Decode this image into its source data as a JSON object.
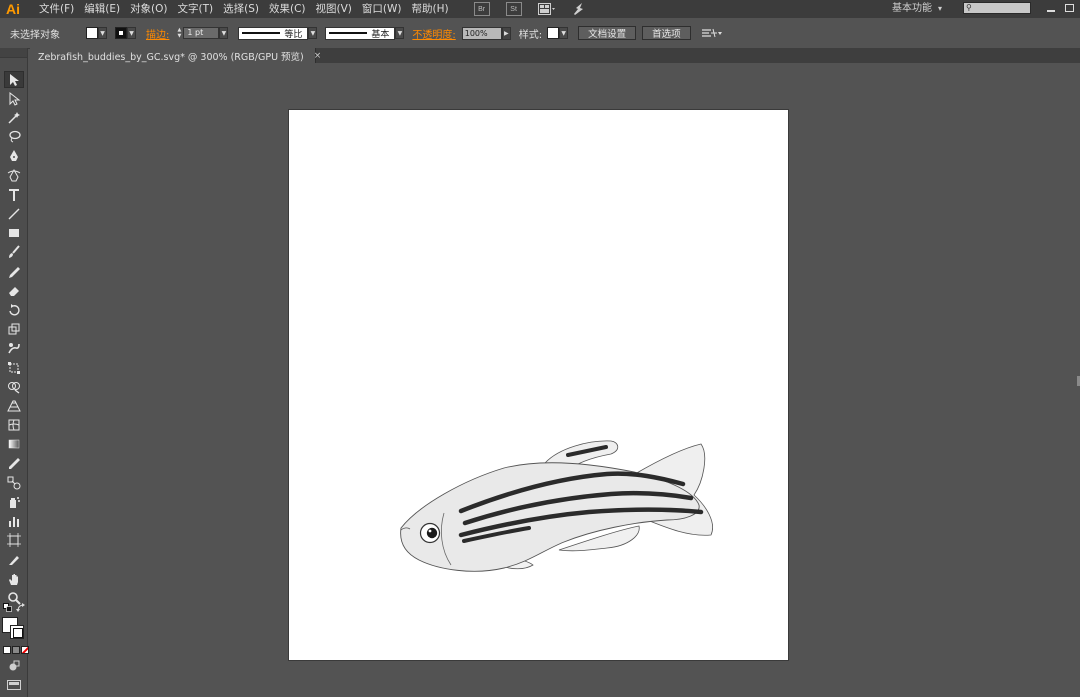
{
  "app": {
    "logo": "Ai"
  },
  "menu": [
    "文件(F)",
    "编辑(E)",
    "对象(O)",
    "文字(T)",
    "选择(S)",
    "效果(C)",
    "视图(V)",
    "窗口(W)",
    "帮助(H)"
  ],
  "menu_icons": [
    {
      "name": "bridge-icon",
      "label": "Br"
    },
    {
      "name": "stock-icon",
      "label": "St"
    },
    {
      "name": "arrange-documents-icon",
      "label": ""
    },
    {
      "name": "gpu-performance-icon",
      "label": ""
    }
  ],
  "workspace": {
    "label": "基本功能",
    "caret": "▾"
  },
  "search": {
    "placeholder": ""
  },
  "control": {
    "selection_status": "未选择对象",
    "stroke_label": "描边:",
    "stroke_weight": "1 pt",
    "profile1_label": "等比",
    "profile2_label": "基本",
    "opacity_label": "不透明度:",
    "opacity_value": "100%",
    "style_label": "样式:",
    "doc_setup_label": "文档设置",
    "prefs_label": "首选项"
  },
  "document": {
    "tab_title": "Zebrafish_buddies_by_GC.svg* @ 300% (RGB/GPU 预览)",
    "close_symbol": "×"
  },
  "colors": {
    "accent_orange": "#ff8a00",
    "fish_body": "#e8e8e8",
    "fish_stripe": "#2b2b2b",
    "artboard": "#ffffff",
    "pasteboard": "#535353"
  },
  "tools": [
    "selection-tool-icon",
    "direct-selection-tool-icon",
    "magic-wand-tool-icon",
    "lasso-tool-icon",
    "pen-tool-icon",
    "curvature-tool-icon",
    "type-tool-icon",
    "line-segment-tool-icon",
    "rectangle-tool-icon",
    "paintbrush-tool-icon",
    "pencil-tool-icon",
    "eraser-tool-icon",
    "rotate-tool-icon",
    "scale-tool-icon",
    "warp-tool-icon",
    "free-transform-tool-icon",
    "shape-builder-tool-icon",
    "perspective-grid-tool-icon",
    "mesh-tool-icon",
    "gradient-tool-icon",
    "eyedropper-tool-icon",
    "blend-tool-icon",
    "symbol-sprayer-tool-icon",
    "column-graph-tool-icon",
    "artboard-tool-icon",
    "slice-tool-icon",
    "hand-tool-icon",
    "zoom-tool-icon"
  ]
}
